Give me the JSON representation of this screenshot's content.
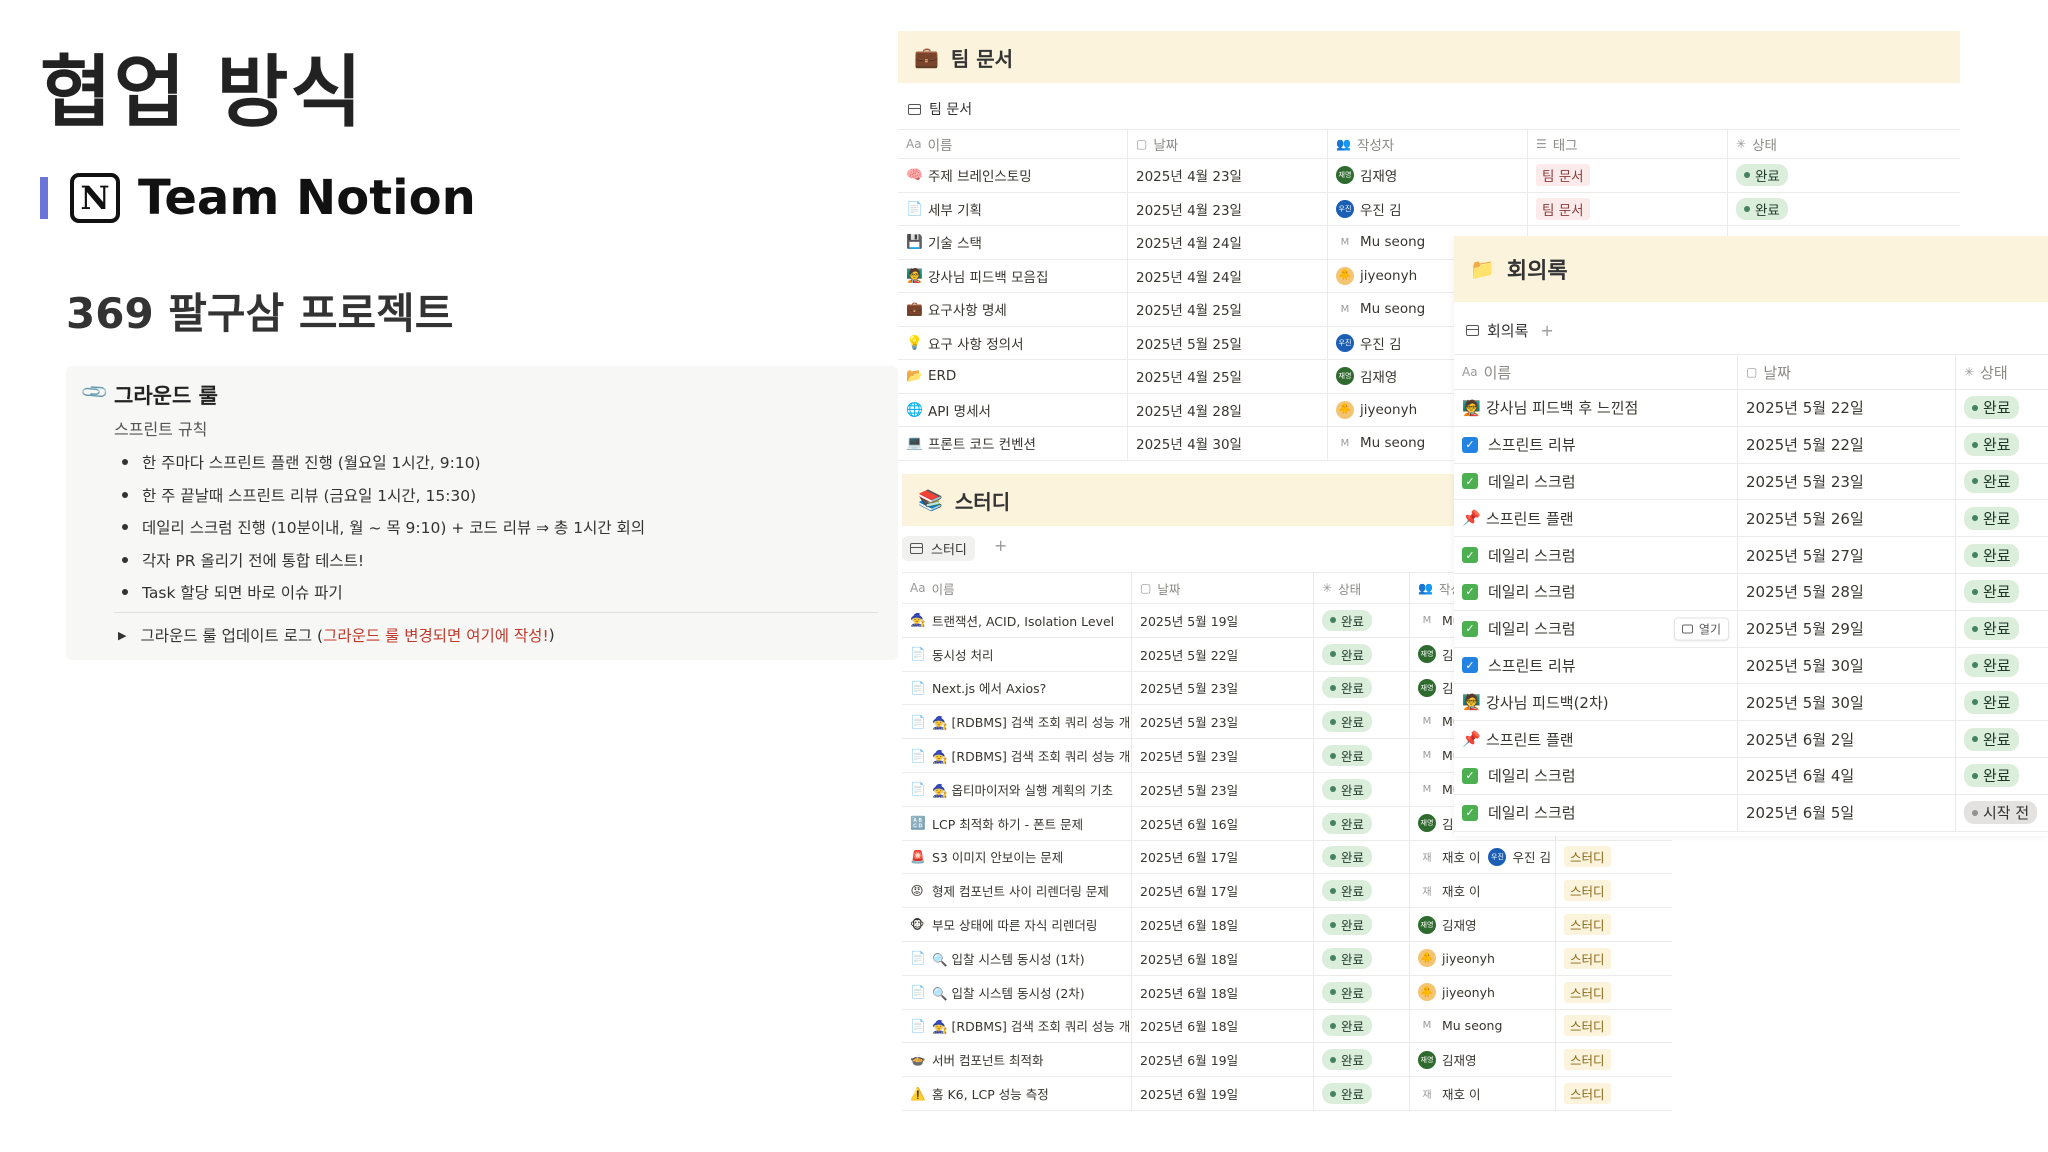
{
  "slide": {
    "title": "협업 방식",
    "team_logo": "N",
    "team_name": "Team Notion",
    "project_title": "369 팔구삼 프로젝트"
  },
  "ground_rules": {
    "title": "그라운드 룰",
    "subtitle": "스프린트 규칙",
    "items": [
      "한 주마다 스프린트 플랜 진행 (월요일 1시간, 9:10)",
      "한 주 끝날때 스프린트 리뷰 (금요일 1시간, 15:30)",
      "데일리 스크럼 진행 (10분이내, 월 ~ 목 9:10) + 코드 리뷰 ⇒ 총 1시간 회의",
      "각자 PR 올리기 전에 통합 테스트!",
      "Task 할당 되면 바로 이슈 파기"
    ],
    "toggle_prefix": "그라운드 룰 업데이트 로그 (",
    "toggle_highlight": "그라운드 룰 변경되면 여기에 작성!",
    "toggle_suffix": ")"
  },
  "team_docs": {
    "icon": "💼",
    "title": "팀 문서",
    "view_label": "팀 문서",
    "headers": {
      "name": "이름",
      "date": "날짜",
      "author": "작성자",
      "tag": "태그",
      "status": "상태"
    },
    "header_prefix": "Aa",
    "rows": [
      {
        "icon": "🧠",
        "name": "주제 브레인스토밍",
        "date": "2025년 4월 23일",
        "author": "김재영",
        "avatar": "green",
        "avatar_text": "재영",
        "tag": "팀 문서",
        "status": "완료"
      },
      {
        "icon": "📄",
        "name": "세부 기획",
        "date": "2025년 4월 23일",
        "author": "우진 김",
        "avatar": "blue",
        "avatar_text": "우진",
        "tag": "팀 문서",
        "status": "완료"
      },
      {
        "icon": "💾",
        "name": "기술 스택",
        "date": "2025년 4월 24일",
        "author": "Mu seong",
        "avatar": "m",
        "avatar_text": "M",
        "tag": "",
        "status": ""
      },
      {
        "icon": "🧑‍🏫",
        "name": "강사님 피드백 모음집",
        "date": "2025년 4월 24일",
        "author": "jiyeonyh",
        "avatar": "yellow",
        "avatar_text": "🐥",
        "tag": "",
        "status": ""
      },
      {
        "icon": "💼",
        "name": "요구사항 명세",
        "date": "2025년 4월 25일",
        "author": "Mu seong",
        "avatar": "m",
        "avatar_text": "M",
        "tag": "",
        "status": ""
      },
      {
        "icon": "💡",
        "name": "요구 사항 정의서",
        "date": "2025년 5월 25일",
        "author": "우진 김",
        "avatar": "blue",
        "avatar_text": "우진",
        "tag": "",
        "status": ""
      },
      {
        "icon": "📂",
        "name": "ERD",
        "date": "2025년 4월 25일",
        "author": "김재영",
        "avatar": "green",
        "avatar_text": "재영",
        "tag": "",
        "status": ""
      },
      {
        "icon": "🌐",
        "name": "API 명세서",
        "date": "2025년 4월 28일",
        "author": "jiyeonyh",
        "avatar": "yellow",
        "avatar_text": "🐥",
        "tag": "",
        "status": ""
      },
      {
        "icon": "💻",
        "name": "프론트 코드 컨벤션",
        "date": "2025년 4월 30일",
        "author": "Mu seong",
        "avatar": "m",
        "avatar_text": "M",
        "tag": "",
        "status": ""
      }
    ]
  },
  "study": {
    "icon": "📚",
    "title": "스터디",
    "view_label": "스터디",
    "plus": "+",
    "headers": {
      "name": "이름",
      "date": "날짜",
      "status": "상태",
      "author": "작성"
    },
    "header_prefix": "Aa",
    "rows": [
      {
        "icon": "🧙",
        "name": "트랜잭션, ACID, Isolation Level",
        "date": "2025년 5월 19일",
        "status": "완료",
        "author": "Mu",
        "avatar": "m",
        "avatar_text": "M",
        "tag": ""
      },
      {
        "icon": "📄",
        "name": "동시성 처리",
        "date": "2025년 5월 22일",
        "status": "완료",
        "author": "김",
        "avatar": "green",
        "avatar_text": "재영",
        "tag": ""
      },
      {
        "icon": "📄",
        "name": "Next.js 에서 Axios?",
        "date": "2025년 5월 23일",
        "status": "완료",
        "author": "김",
        "avatar": "green",
        "avatar_text": "재영",
        "tag": ""
      },
      {
        "icon": "📄",
        "name": "🧙 [RDBMS] 검색 조회 쿼리 성능 개선",
        "date": "2025년 5월 23일",
        "status": "완료",
        "author": "Mu",
        "avatar": "m",
        "avatar_text": "M",
        "tag": ""
      },
      {
        "icon": "📄",
        "name": "🧙 [RDBMS] 검색 조회 쿼리 성능 개선",
        "date": "2025년 5월 23일",
        "status": "완료",
        "author": "Mu",
        "avatar": "m",
        "avatar_text": "M",
        "tag": ""
      },
      {
        "icon": "📄",
        "name": "🧙 옵티마이저와 실행 계획의 기초",
        "date": "2025년 5월 23일",
        "status": "완료",
        "author": "Mu",
        "avatar": "m",
        "avatar_text": "M",
        "tag": ""
      },
      {
        "icon": "🔠",
        "name": "LCP 최적화 하기 - 폰트 문제",
        "date": "2025년 6월 16일",
        "status": "완료",
        "author": "김",
        "avatar": "green",
        "avatar_text": "재영",
        "tag": ""
      },
      {
        "icon": "🚨",
        "name": "S3 이미지 안보이는 문제",
        "date": "2025년 6월 17일",
        "status": "완료",
        "author": "재호 이",
        "avatar": "m",
        "avatar_text": "재",
        "author2": "우진 김",
        "tag": "스터디"
      },
      {
        "icon": "😡",
        "name": "형제 컴포넌트 사이 리렌더링 문제",
        "date": "2025년 6월 17일",
        "status": "완료",
        "author": "재호 이",
        "avatar": "m",
        "avatar_text": "재",
        "tag": "스터디"
      },
      {
        "icon": "🐵",
        "name": "부모 상태에 따른 자식 리렌더링",
        "date": "2025년 6월 18일",
        "status": "완료",
        "author": "김재영",
        "avatar": "green",
        "avatar_text": "재영",
        "tag": "스터디"
      },
      {
        "icon": "📄",
        "name": "🔍 입찰 시스템 동시성 (1차)",
        "date": "2025년 6월 18일",
        "status": "완료",
        "author": "jiyeonyh",
        "avatar": "yellow",
        "avatar_text": "🐥",
        "tag": "스터디"
      },
      {
        "icon": "📄",
        "name": "🔍 입찰 시스템 동시성 (2차)",
        "date": "2025년 6월 18일",
        "status": "완료",
        "author": "jiyeonyh",
        "avatar": "yellow",
        "avatar_text": "🐥",
        "tag": "스터디"
      },
      {
        "icon": "📄",
        "name": "🧙 [RDBMS] 검색 조회 쿼리 성능 개선",
        "date": "2025년 6월 18일",
        "status": "완료",
        "author": "Mu seong",
        "avatar": "m",
        "avatar_text": "M",
        "tag": "스터디"
      },
      {
        "icon": "🍲",
        "name": "서버 컴포넌트 최적화",
        "date": "2025년 6월 19일",
        "status": "완료",
        "author": "김재영",
        "avatar": "green",
        "avatar_text": "재영",
        "tag": "스터디"
      },
      {
        "icon": "⚠️",
        "name": "홈 K6, LCP 성능 측정",
        "date": "2025년 6월 19일",
        "status": "완료",
        "author": "재호 이",
        "avatar": "m",
        "avatar_text": "재",
        "tag": "스터디"
      }
    ]
  },
  "meeting_notes": {
    "icon": "📁",
    "title": "회의록",
    "view_label": "회의록",
    "plus": "+",
    "open_label": "열기",
    "headers": {
      "name": "이름",
      "date": "날짜",
      "status": "상태"
    },
    "header_prefix": "Aa",
    "rows": [
      {
        "icon": "feedback",
        "name": "강사님 피드백 후 느낀점",
        "date": "2025년 5월 22일",
        "status": "완료"
      },
      {
        "icon": "check-blue",
        "name": "스프린트 리뷰",
        "date": "2025년 5월 22일",
        "status": "완료"
      },
      {
        "icon": "check-green",
        "name": "데일리 스크럼",
        "date": "2025년 5월 23일",
        "status": "완료"
      },
      {
        "icon": "pin",
        "name": "스프린트 플랜",
        "date": "2025년 5월 26일",
        "status": "완료"
      },
      {
        "icon": "check-green",
        "name": "데일리 스크럼",
        "date": "2025년 5월 27일",
        "status": "완료"
      },
      {
        "icon": "check-green",
        "name": "데일리 스크럼",
        "date": "2025년 5월 28일",
        "status": "완료"
      },
      {
        "icon": "check-green",
        "name": "데일리 스크럼",
        "date": "2025년 5월 29일",
        "status": "완료",
        "show_open": true
      },
      {
        "icon": "check-blue",
        "name": "스프린트 리뷰",
        "date": "2025년 5월 30일",
        "status": "완료"
      },
      {
        "icon": "feedback",
        "name": "강사님 피드백(2차)",
        "date": "2025년 5월 30일",
        "status": "완료"
      },
      {
        "icon": "pin",
        "name": "스프린트 플랜",
        "date": "2025년 6월 2일",
        "status": "완료"
      },
      {
        "icon": "check-green",
        "name": "데일리 스크럼",
        "date": "2025년 6월 4일",
        "status": "완료"
      },
      {
        "icon": "check-green",
        "name": "데일리 스크럼",
        "date": "2025년 6월 5일",
        "status": "시작 전"
      }
    ]
  },
  "colors": {
    "accent_bar": "#6b74d8",
    "panel_header_bg": "#fbf3dc",
    "done_badge_bg": "#dbeddb",
    "doc_tag_bg": "#fdebec",
    "study_tag_bg": "#fbf3db"
  }
}
